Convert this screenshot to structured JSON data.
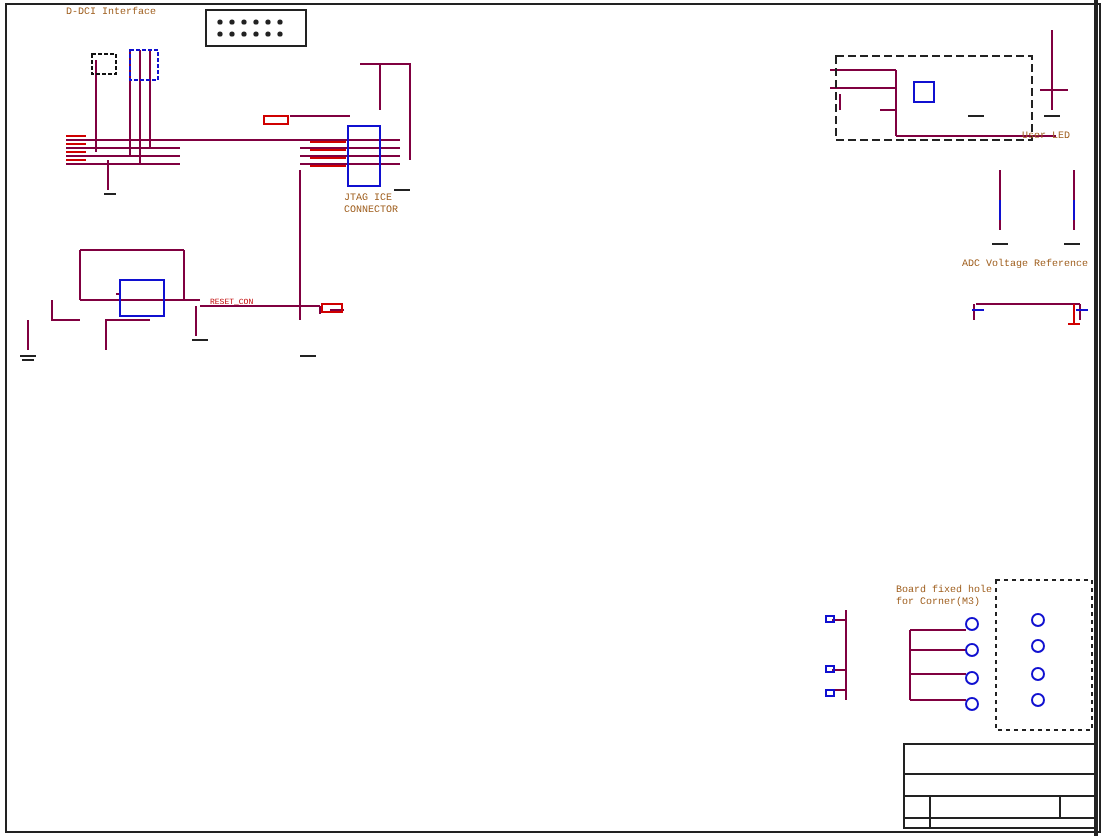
{
  "sheet": {
    "labels": [
      {
        "text": "D-DCI Interface",
        "kind": "heading"
      },
      {
        "text": "JTAG ICE",
        "kind": "heading"
      },
      {
        "text": "CONNECTOR",
        "kind": "heading"
      },
      {
        "text": "RESET_CON",
        "kind": "net"
      },
      {
        "text": "User LED",
        "kind": "heading"
      },
      {
        "text": "ADC Voltage Reference",
        "kind": "heading"
      },
      {
        "text": "Board fixed hole",
        "kind": "heading"
      },
      {
        "text": "for Corner(M3)",
        "kind": "heading"
      }
    ]
  }
}
